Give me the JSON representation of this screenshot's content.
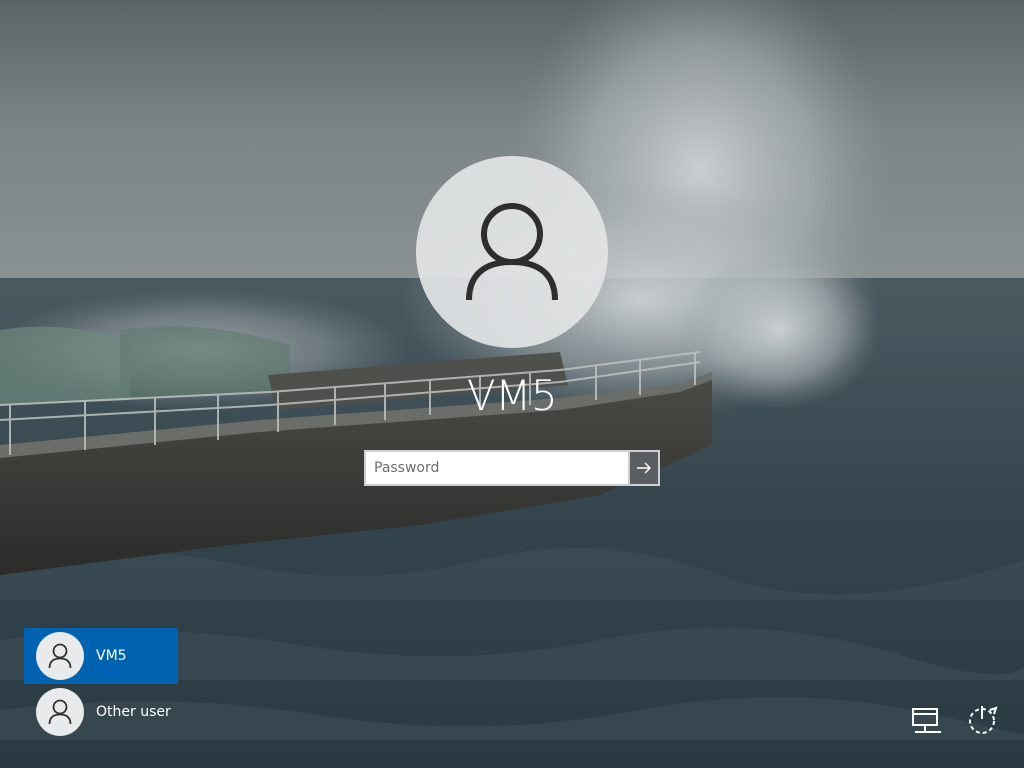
{
  "lock_screen": {
    "user_name": "VM5",
    "password": {
      "placeholder": "Password",
      "value": ""
    },
    "submit_icon": "arrow-right-icon"
  },
  "user_list": [
    {
      "name": "VM5",
      "selected": true,
      "icon": "user-icon"
    },
    {
      "name": "Other user",
      "selected": false,
      "icon": "user-icon"
    }
  ],
  "corner_icons": [
    "network-icon",
    "power-icon"
  ],
  "colors": {
    "selection_accent": "#0063b1",
    "avatar_background": "#e2e4e5",
    "text": "#ffffff"
  }
}
